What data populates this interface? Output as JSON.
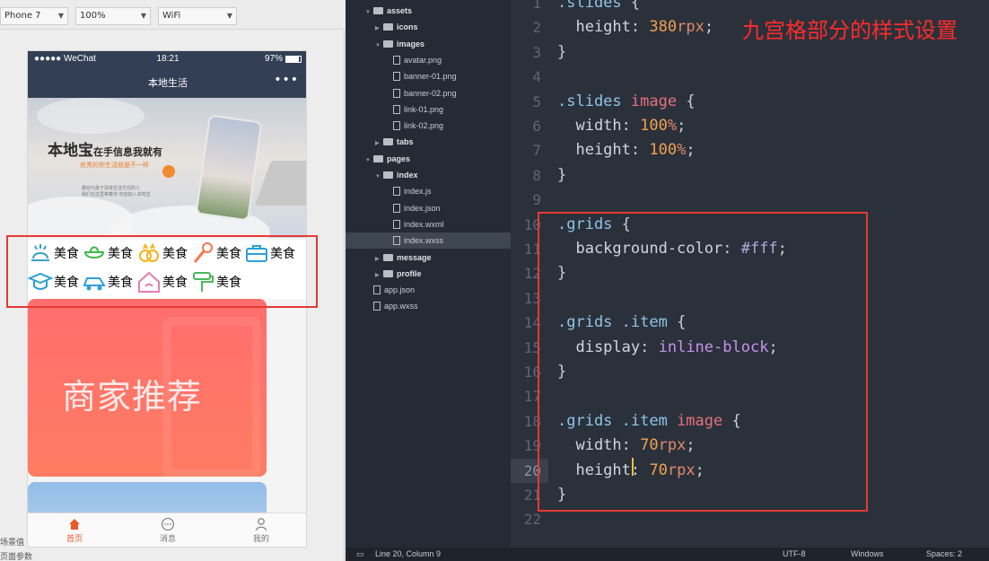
{
  "simulator": {
    "device": "Phone 7",
    "zoom": "100%",
    "network": "WiFi",
    "status_bar": {
      "carrier": "●●●●● WeChat",
      "time": "18:21",
      "battery": "97%"
    },
    "nav_title": "本地生活",
    "nav_menu": "•••",
    "banner": {
      "title": "本地宝",
      "title_suffix": "在手信息我就有",
      "subtitle": "优秀的你生活就是不一样",
      "desc": "挪动为勇于改变生活方式的人\n我们在这里等着你 欢迎加入本地宝"
    },
    "grid_items": [
      {
        "icon": "food-icon",
        "label": "美食"
      },
      {
        "icon": "bowl-icon",
        "label": "美食"
      },
      {
        "icon": "rings-icon",
        "label": "美食"
      },
      {
        "icon": "microphone-icon",
        "label": "美食"
      },
      {
        "icon": "briefcase-icon",
        "label": "美食"
      },
      {
        "icon": "graduation-cap-icon",
        "label": "美食"
      },
      {
        "icon": "car-icon",
        "label": "美食"
      },
      {
        "icon": "house-icon",
        "label": "美食"
      },
      {
        "icon": "paint-roller-icon",
        "label": "美食"
      }
    ],
    "card_text": "商家推荐",
    "tabs": [
      {
        "label": "首页",
        "icon": "home-icon",
        "active": true
      },
      {
        "label": "消息",
        "icon": "message-icon",
        "active": false
      },
      {
        "label": "我的",
        "icon": "profile-icon",
        "active": false
      }
    ],
    "footer_1": "场景值",
    "footer_2": "页面参数"
  },
  "tree": [
    {
      "label": "assets",
      "depth": 0,
      "type": "folder",
      "open": true,
      "bold": true
    },
    {
      "label": "icons",
      "depth": 1,
      "type": "folder",
      "open": false,
      "bold": true
    },
    {
      "label": "images",
      "depth": 1,
      "type": "folder",
      "open": true,
      "bold": true
    },
    {
      "label": "avatar.png",
      "depth": 2,
      "type": "file"
    },
    {
      "label": "banner-01.png",
      "depth": 2,
      "type": "file"
    },
    {
      "label": "banner-02.png",
      "depth": 2,
      "type": "file"
    },
    {
      "label": "link-01.png",
      "depth": 2,
      "type": "file"
    },
    {
      "label": "link-02.png",
      "depth": 2,
      "type": "file"
    },
    {
      "label": "tabs",
      "depth": 1,
      "type": "folder",
      "open": false,
      "bold": true
    },
    {
      "label": "pages",
      "depth": 0,
      "type": "folder",
      "open": true,
      "bold": true
    },
    {
      "label": "index",
      "depth": 1,
      "type": "folder",
      "open": true,
      "bold": true
    },
    {
      "label": "index.js",
      "depth": 2,
      "type": "file"
    },
    {
      "label": "index.json",
      "depth": 2,
      "type": "file"
    },
    {
      "label": "index.wxml",
      "depth": 2,
      "type": "file"
    },
    {
      "label": "index.wxss",
      "depth": 2,
      "type": "file",
      "selected": true
    },
    {
      "label": "message",
      "depth": 1,
      "type": "folder",
      "open": false,
      "bold": true
    },
    {
      "label": "profile",
      "depth": 1,
      "type": "folder",
      "open": false,
      "bold": true
    },
    {
      "label": "app.json",
      "depth": 0,
      "type": "file"
    },
    {
      "label": "app.wxss",
      "depth": 0,
      "type": "file"
    }
  ],
  "editor": {
    "caption": "九宫格部分的样式设置",
    "current_line": 20,
    "lines": [
      {
        "n": "1",
        "tokens": [
          {
            "c": "sel-c",
            "t": ".slides"
          },
          {
            "c": "punc-c",
            "t": " {"
          }
        ]
      },
      {
        "n": "2",
        "tokens": [
          {
            "c": "prop-c",
            "t": "  height"
          },
          {
            "c": "punc-c",
            "t": ": "
          },
          {
            "c": "num-c",
            "t": "380"
          },
          {
            "c": "unit-c",
            "t": "rpx"
          },
          {
            "c": "punc-c",
            "t": ";"
          }
        ]
      },
      {
        "n": "3",
        "tokens": [
          {
            "c": "punc-c",
            "t": "}"
          }
        ]
      },
      {
        "n": "4",
        "tokens": []
      },
      {
        "n": "5",
        "tokens": [
          {
            "c": "sel-c",
            "t": ".slides "
          },
          {
            "c": "tag-c",
            "t": "image"
          },
          {
            "c": "punc-c",
            "t": " {"
          }
        ]
      },
      {
        "n": "6",
        "tokens": [
          {
            "c": "prop-c",
            "t": "  width"
          },
          {
            "c": "punc-c",
            "t": ": "
          },
          {
            "c": "num-c",
            "t": "100"
          },
          {
            "c": "unit-c",
            "t": "%"
          },
          {
            "c": "punc-c",
            "t": ";"
          }
        ]
      },
      {
        "n": "7",
        "tokens": [
          {
            "c": "prop-c",
            "t": "  height"
          },
          {
            "c": "punc-c",
            "t": ": "
          },
          {
            "c": "num-c",
            "t": "100"
          },
          {
            "c": "unit-c",
            "t": "%"
          },
          {
            "c": "punc-c",
            "t": ";"
          }
        ]
      },
      {
        "n": "8",
        "tokens": [
          {
            "c": "punc-c",
            "t": "}"
          }
        ]
      },
      {
        "n": "9",
        "tokens": []
      },
      {
        "n": "10",
        "tokens": [
          {
            "c": "sel-c",
            "t": ".grids"
          },
          {
            "c": "punc-c",
            "t": " {"
          }
        ]
      },
      {
        "n": "11",
        "tokens": [
          {
            "c": "prop-c",
            "t": "  background-color"
          },
          {
            "c": "punc-c",
            "t": ": "
          },
          {
            "c": "hex-c",
            "t": "#fff"
          },
          {
            "c": "punc-c",
            "t": ";"
          }
        ]
      },
      {
        "n": "12",
        "tokens": [
          {
            "c": "punc-c",
            "t": "}"
          }
        ]
      },
      {
        "n": "13",
        "tokens": []
      },
      {
        "n": "14",
        "tokens": [
          {
            "c": "sel-c",
            "t": ".grids .item"
          },
          {
            "c": "punc-c",
            "t": " {"
          }
        ]
      },
      {
        "n": "15",
        "tokens": [
          {
            "c": "prop-c",
            "t": "  display"
          },
          {
            "c": "punc-c",
            "t": ": "
          },
          {
            "c": "kw-c",
            "t": "inline-block"
          },
          {
            "c": "punc-c",
            "t": ";"
          }
        ]
      },
      {
        "n": "16",
        "tokens": [
          {
            "c": "punc-c",
            "t": "}"
          }
        ]
      },
      {
        "n": "17",
        "tokens": []
      },
      {
        "n": "18",
        "tokens": [
          {
            "c": "sel-c",
            "t": ".grids .item "
          },
          {
            "c": "tag-c",
            "t": "image"
          },
          {
            "c": "punc-c",
            "t": " {"
          }
        ]
      },
      {
        "n": "19",
        "tokens": [
          {
            "c": "prop-c",
            "t": "  width"
          },
          {
            "c": "punc-c",
            "t": ": "
          },
          {
            "c": "num-c",
            "t": "70"
          },
          {
            "c": "unit-c",
            "t": "rpx"
          },
          {
            "c": "punc-c",
            "t": ";"
          }
        ]
      },
      {
        "n": "20",
        "tokens": [
          {
            "c": "prop-c",
            "t": "  height"
          },
          {
            "c": "punc-c",
            "t": ": "
          },
          {
            "c": "num-c",
            "t": "70"
          },
          {
            "c": "unit-c",
            "t": "rpx"
          },
          {
            "c": "punc-c",
            "t": ";"
          }
        ]
      },
      {
        "n": "21",
        "tokens": [
          {
            "c": "punc-c",
            "t": "}"
          }
        ]
      },
      {
        "n": "22",
        "tokens": []
      }
    ]
  },
  "statusline": {
    "position": "Line 20, Column 9",
    "encoding": "UTF-8",
    "line_endings": "Windows",
    "indent": "Spaces: 2"
  },
  "colors": {
    "accent_red": "#e53935",
    "nav_bg": "#333f55",
    "editor_bg": "#2b313b"
  }
}
